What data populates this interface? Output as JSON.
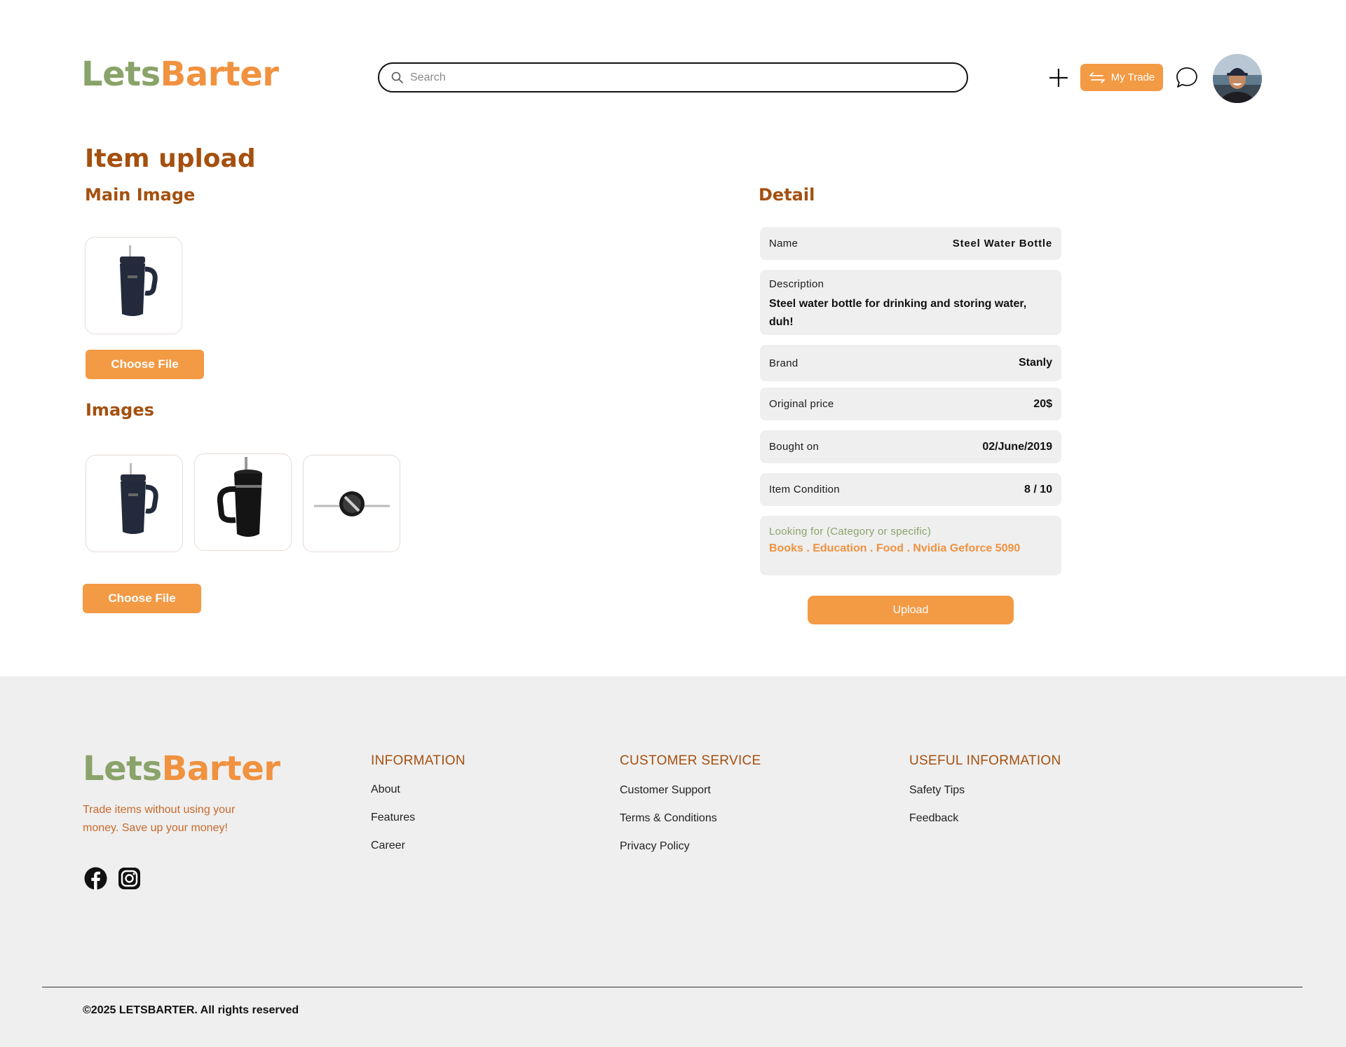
{
  "header": {
    "logo_part1": "Lets",
    "logo_part2": "Barter",
    "search_placeholder": "Search",
    "my_trade_label": "My Trade",
    "icons": [
      "search-icon",
      "plus-icon",
      "swap-icon",
      "chat-icon"
    ]
  },
  "page": {
    "title": "Item upload",
    "main_image_heading": "Main Image",
    "images_heading": "Images",
    "choose_file_label": "Choose File",
    "detail_heading": "Detail"
  },
  "detail": {
    "name_label": "Name",
    "name_value": "Steel Water Bottle",
    "description_label": "Description",
    "description_value": "Steel water bottle for drinking and storing water, duh!",
    "brand_label": "Brand",
    "brand_value": "Stanly",
    "price_label": "Original price",
    "price_value": "20$",
    "bought_label": "Bought on",
    "bought_value": "02/June/2019",
    "condition_label": "Item Condition",
    "condition_value": "8 / 10",
    "looking_label": "Looking for (Category or specific)",
    "looking_value": "Books . Education . Food . Nvidia Geforce 5090",
    "upload_label": "Upload"
  },
  "footer": {
    "logo_part1": "Lets",
    "logo_part2": "Barter",
    "tagline": "Trade items without using your money. Save up your money!",
    "information": {
      "title": "INFORMATION",
      "links": [
        "About",
        "Features",
        "Career"
      ]
    },
    "customer_service": {
      "title": "CUSTOMER SERVICE",
      "links": [
        "Customer Support",
        "Terms & Conditions",
        "Privacy Policy"
      ]
    },
    "useful_information": {
      "title": "USEFUL INFORMATION",
      "links": [
        "Safety Tips",
        "Feedback"
      ]
    },
    "copyright": "©2025 LETSBARTER. All rights reserved",
    "social_icons": [
      "facebook-icon",
      "instagram-icon"
    ]
  },
  "colors": {
    "accent_orange": "#f39a45",
    "brand_green": "#8aa36a",
    "heading_brown": "#a4500f",
    "footer_bg": "#efefef"
  }
}
